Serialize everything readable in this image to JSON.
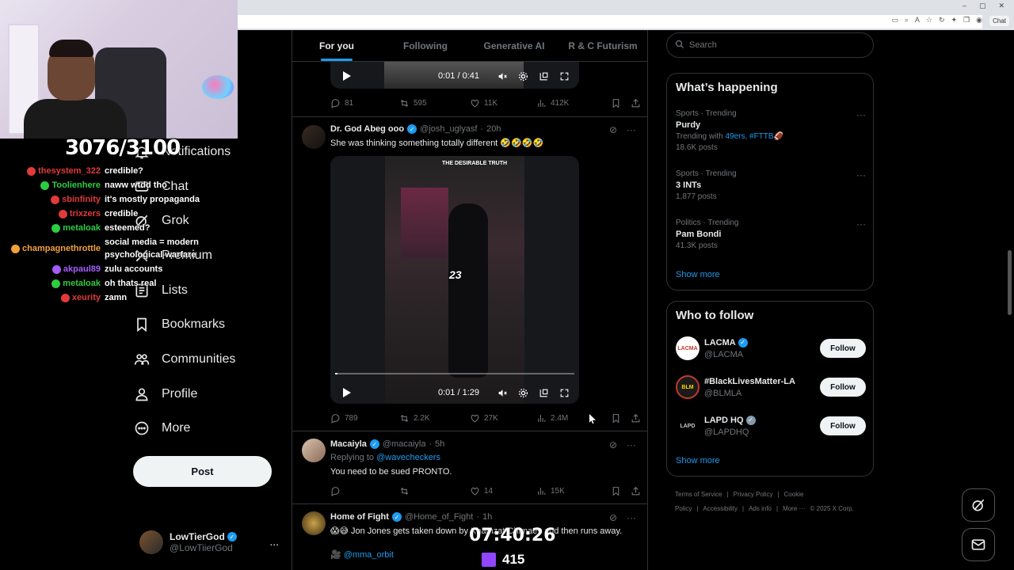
{
  "browser": {
    "chat_label": "Chat"
  },
  "stream_overlay": {
    "sub_goal": "3076/3100",
    "timer": "07:40:26",
    "viewers": "415",
    "chat": [
      {
        "user": "thesystem_322",
        "color": "#e03a3a",
        "message": "credible?"
      },
      {
        "user": "Toolienhere",
        "color": "#2ecc40",
        "message": "naww wtdd tho"
      },
      {
        "user": "sbinfinity",
        "color": "#e03a3a",
        "message": "it's mostly propaganda"
      },
      {
        "user": "trixzers",
        "color": "#e03a3a",
        "message": "credible"
      },
      {
        "user": "metaloak",
        "color": "#2ecc40",
        "message": "esteemed?"
      },
      {
        "user": "champagnethrottle",
        "color": "#f1a03a",
        "message": "social media = modern psychological warfare"
      },
      {
        "user": "akpaul89",
        "color": "#a45cff",
        "message": "zulu accounts"
      },
      {
        "user": "metaloak",
        "color": "#2ecc40",
        "message": "oh thats real"
      },
      {
        "user": "xeurity",
        "color": "#e03a3a",
        "message": "zamn"
      }
    ]
  },
  "nav": {
    "items": [
      {
        "label": "Notifications",
        "icon": "bell-icon"
      },
      {
        "label": "Chat",
        "icon": "chat-icon"
      },
      {
        "label": "Grok",
        "icon": "grok-icon"
      },
      {
        "label": "Premium",
        "icon": "x-logo-icon"
      },
      {
        "label": "Lists",
        "icon": "list-icon"
      },
      {
        "label": "Bookmarks",
        "icon": "bookmark-icon"
      },
      {
        "label": "Communities",
        "icon": "people-icon"
      },
      {
        "label": "Profile",
        "icon": "person-icon"
      },
      {
        "label": "More",
        "icon": "more-circle-icon"
      }
    ],
    "post_label": "Post",
    "account": {
      "name": "LowTierGod",
      "handle": "@LowTiierGod",
      "more": "..."
    }
  },
  "tabs": [
    {
      "label": "For you",
      "active": true
    },
    {
      "label": "Following",
      "active": false
    },
    {
      "label": "Generative AI",
      "active": false
    },
    {
      "label": "R & C Futurism",
      "active": false
    }
  ],
  "tweets": [
    {
      "video_time": "0:01 / 0:41",
      "stats": {
        "replies": "81",
        "reposts": "595",
        "likes": "11K",
        "views": "412K"
      }
    },
    {
      "name": "Dr. God Abeg ooo",
      "handle": "@josh_uglyasf",
      "time": "20h",
      "text": "She was thinking something totally different 🤣🤣🤣🤣",
      "video_logo": "THE DESIRABLE TRUTH",
      "video_overlay": "23",
      "video_time": "0:01 / 1:29",
      "video_progress": 0.01,
      "stats": {
        "replies": "789",
        "reposts": "2.2K",
        "likes": "27K",
        "views": "2.4M"
      }
    },
    {
      "name": "Macaiyla",
      "handle": "@macaiyla",
      "time": "5h",
      "reply_prefix": "Replying to",
      "reply_to": "@wavecheckers",
      "text": "You need to be sued PRONTO.",
      "stats": {
        "replies": "",
        "reposts": "",
        "likes": "14",
        "views": "15K"
      }
    },
    {
      "name": "Home of Fight",
      "handle": "@Home_of_Fight",
      "time": "1h",
      "text": "😱😅 Jon Jones gets taken down by Khamzat Chimaev and then runs away.",
      "link": "@mma_orbit"
    }
  ],
  "search": {
    "placeholder": "Search"
  },
  "whats_happening": {
    "title": "What’s happening",
    "trends": [
      {
        "category": "Sports · Trending",
        "name": "Purdy",
        "with_prefix": "Trending with",
        "with": "49ers, #FTTB🏈",
        "posts": "18.6K posts"
      },
      {
        "category": "Sports · Trending",
        "name": "3 INTs",
        "posts": "1,877 posts"
      },
      {
        "category": "Politics · Trending",
        "name": "Pam Bondi",
        "posts": "41.3K posts"
      }
    ],
    "show_more": "Show more"
  },
  "who_to_follow": {
    "title": "Who to follow",
    "accounts": [
      {
        "name": "LACMA",
        "handle": "@LACMA",
        "avatar_text": "LACMA",
        "verified": true
      },
      {
        "name": "#BlackLivesMatter-LA",
        "handle": "@BLMLA",
        "avatar_text": "BLM",
        "verified": false
      },
      {
        "name": "LAPD HQ",
        "handle": "@LAPDHQ",
        "avatar_text": "LAPD",
        "verified": true
      }
    ],
    "follow_label": "Follow",
    "show_more": "Show more"
  },
  "footer": {
    "links": [
      "Terms of Service",
      "|",
      "Privacy Policy",
      "|",
      "Cookie Policy",
      "|",
      "Accessibility",
      "|",
      "Ads info",
      "|",
      "More ···",
      "© 2025 X Corp."
    ]
  },
  "colors": {
    "accent": "#1d9bf0",
    "background": "#000000",
    "border": "#2f3336",
    "muted": "#71767b"
  }
}
